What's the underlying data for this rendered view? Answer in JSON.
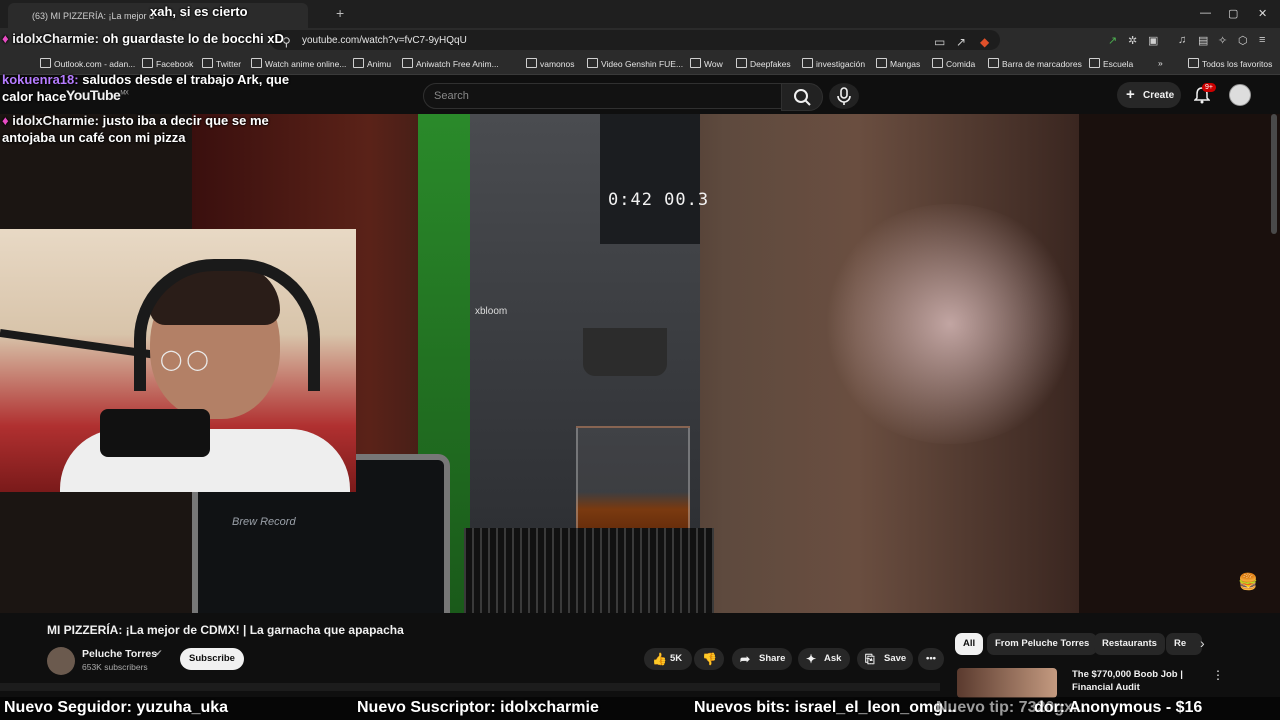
{
  "browser": {
    "tab_title": "(63) MI PIZZERÍA: ¡La mejor d",
    "tab_close": "×",
    "new_tab": "+",
    "window_controls": [
      "—",
      "▢",
      "✕"
    ],
    "url": "youtube.com/watch?v=fvC7-9yHQqU",
    "bookmarks": [
      "Outlook.com - adan...",
      "Facebook",
      "Twitter",
      "Watch anime online...",
      "Animu",
      "Aniwatch Free Anim...",
      "vamonos",
      "Video Genshin FUE...",
      "Wow",
      "Deepfakes",
      "investigación",
      "Mangas",
      "Comida",
      "Barra de marcadores",
      "Escuela",
      "Todos los favoritos"
    ],
    "bookmarks_more": "»"
  },
  "youtube": {
    "logo": "YouTube",
    "logo_region": "MX",
    "search_placeholder": "Search",
    "create_label": "Create",
    "notif_badge": "9+"
  },
  "video": {
    "machine_display": "0:42  00.3",
    "brand": "xbloom",
    "tablet_text": "Brew Record"
  },
  "chat": [
    {
      "user": "",
      "text": "xah, si es cierto"
    },
    {
      "user": "idolxCharmie:",
      "text": "oh guardaste lo de bocchi xD"
    },
    {
      "user": "kokuenra18:",
      "text": "saludos desde el trabajo Ark, que calor hace"
    },
    {
      "user": "idolxCharmie:",
      "text": "justo iba a decir que se me antojaba un café con mi pizza"
    }
  ],
  "info": {
    "title": "MI PIZZERÍA: ¡La mejor de CDMX! | La garnacha que apapacha",
    "channel": "Peluche Torres",
    "subscribers": "653K subscribers",
    "subscribe": "Subscribe",
    "likes": "5K",
    "share": "Share",
    "ask": "Ask",
    "save": "Save",
    "more": "•••"
  },
  "chips": [
    "All",
    "From Peluche Torres",
    "Restaurants",
    "Re"
  ],
  "recommendation": {
    "title": "The $770,000 Boob Job | Financial Audit"
  },
  "ticker": [
    "Nuevo Seguidor: yuzuha_uka",
    "Nuevo Suscriptor: idolxcharmie",
    "Nuevos bits: israel_el_leon_omg...",
    "Nuevo tip: 7320gx...",
    "dor: Anonymous - $16"
  ],
  "colors": {
    "accent_red": "#cc0000",
    "chat_gem": "#e84cc4",
    "username_purple": "#b67cff"
  }
}
